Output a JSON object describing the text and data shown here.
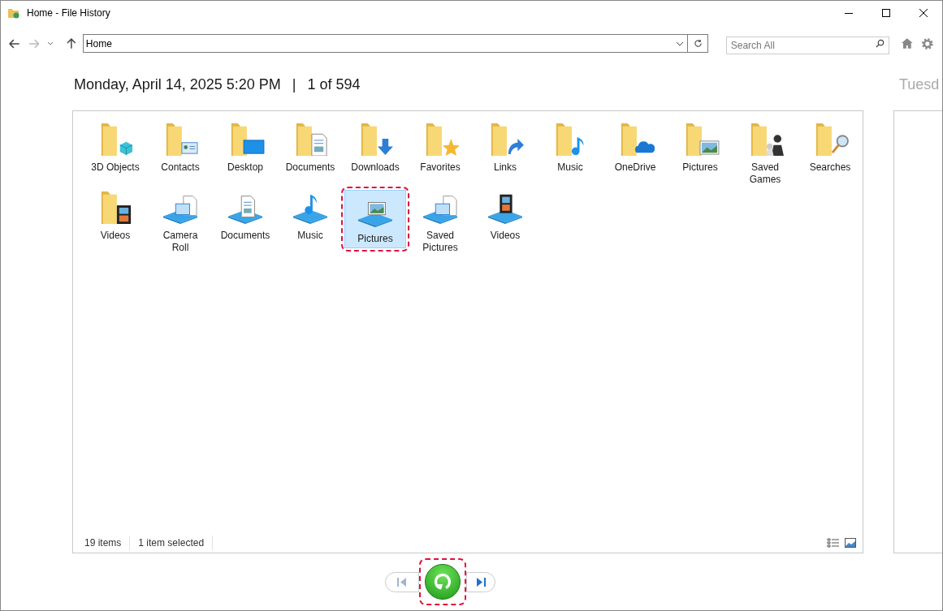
{
  "window": {
    "title": "Home - File History"
  },
  "address_bar": {
    "value": "Home"
  },
  "search": {
    "placeholder": "Search All"
  },
  "snapshot": {
    "date": "Monday, April 14, 2025 5:20 PM",
    "separator": "|",
    "position": "1 of 594",
    "next_date": "Tuesd"
  },
  "items": [
    {
      "label": "3D Objects",
      "kind": "folder",
      "selected": false,
      "highlighted": false
    },
    {
      "label": "Contacts",
      "kind": "folder",
      "selected": false,
      "highlighted": false
    },
    {
      "label": "Desktop",
      "kind": "folder",
      "selected": false,
      "highlighted": false
    },
    {
      "label": "Documents",
      "kind": "folder",
      "selected": false,
      "highlighted": false
    },
    {
      "label": "Downloads",
      "kind": "folder",
      "selected": false,
      "highlighted": false
    },
    {
      "label": "Favorites",
      "kind": "folder",
      "selected": false,
      "highlighted": false
    },
    {
      "label": "Links",
      "kind": "folder",
      "selected": false,
      "highlighted": false
    },
    {
      "label": "Music",
      "kind": "folder",
      "selected": false,
      "highlighted": false
    },
    {
      "label": "OneDrive",
      "kind": "folder",
      "selected": false,
      "highlighted": false
    },
    {
      "label": "Pictures",
      "kind": "folder",
      "selected": false,
      "highlighted": false
    },
    {
      "label": "Saved Games",
      "kind": "folder",
      "selected": false,
      "highlighted": false
    },
    {
      "label": "Searches",
      "kind": "folder",
      "selected": false,
      "highlighted": false
    },
    {
      "label": "Videos",
      "kind": "folder",
      "selected": false,
      "highlighted": false
    },
    {
      "label": "Camera Roll",
      "kind": "library",
      "selected": false,
      "highlighted": false
    },
    {
      "label": "Documents",
      "kind": "library",
      "selected": false,
      "highlighted": false
    },
    {
      "label": "Music",
      "kind": "library",
      "selected": false,
      "highlighted": false
    },
    {
      "label": "Pictures",
      "kind": "library",
      "selected": true,
      "highlighted": true
    },
    {
      "label": "Saved Pictures",
      "kind": "library",
      "selected": false,
      "highlighted": false
    },
    {
      "label": "Videos",
      "kind": "library",
      "selected": false,
      "highlighted": false
    }
  ],
  "status_bar": {
    "count": "19 items",
    "selection": "1 item selected"
  },
  "playback": {
    "previous_disabled": true,
    "restore_highlighted": true
  }
}
